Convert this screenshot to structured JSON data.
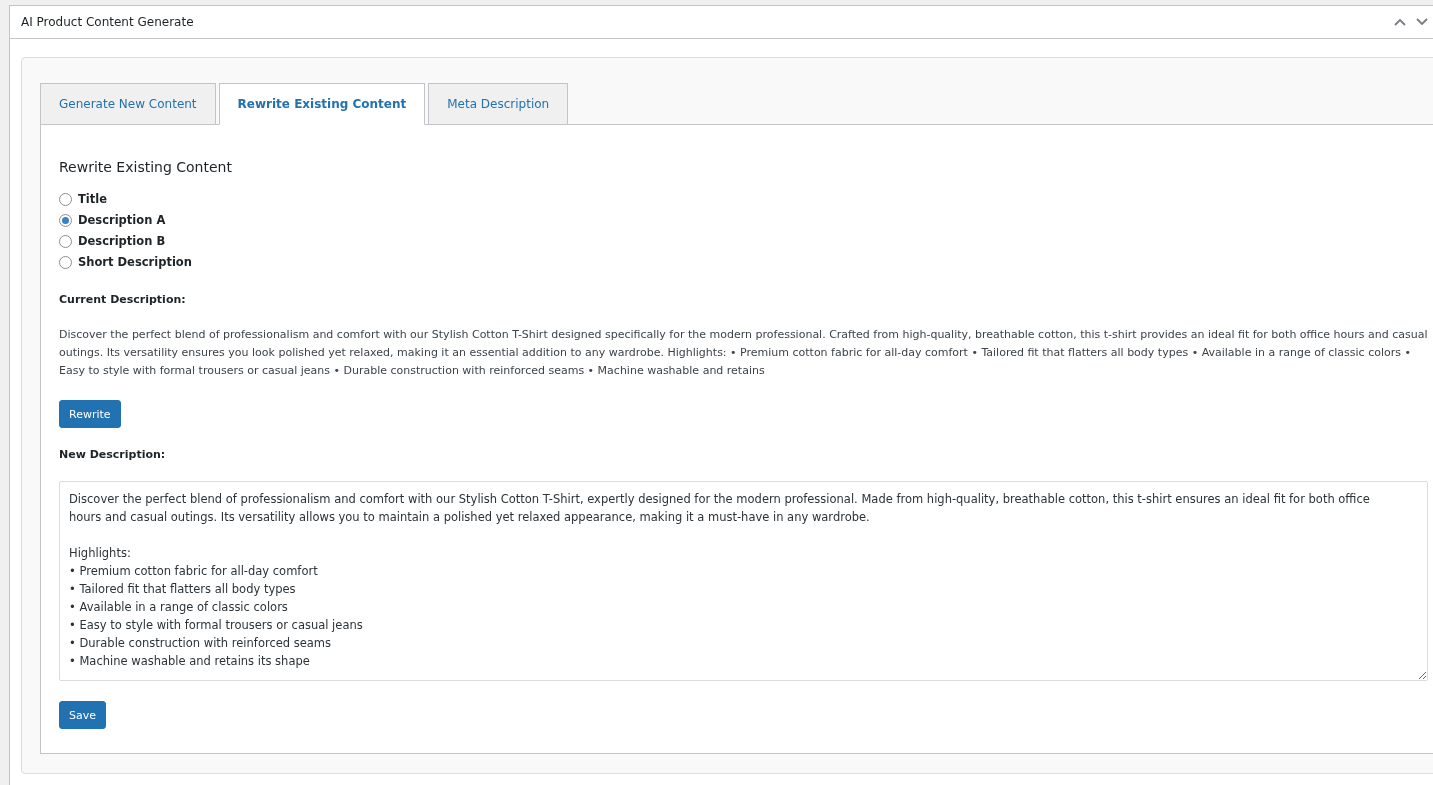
{
  "panel": {
    "title": "AI Product Content Generate"
  },
  "tabs": [
    {
      "label": "Generate New Content",
      "selected": false
    },
    {
      "label": "Rewrite Existing Content",
      "selected": true
    },
    {
      "label": "Meta Description",
      "selected": false
    }
  ],
  "section_title": "Rewrite Existing Content",
  "options": [
    {
      "label": "Title",
      "selected": false
    },
    {
      "label": "Description A",
      "selected": true
    },
    {
      "label": "Description B",
      "selected": false
    },
    {
      "label": "Short Description",
      "selected": false
    }
  ],
  "current": {
    "label": "Current Description:",
    "text": "Discover the perfect blend of professionalism and comfort with our Stylish Cotton T-Shirt designed specifically for the modern professional. Crafted from high-quality, breathable cotton, this t-shirt provides an ideal fit for both office hours and casual outings. Its versatility ensures you look polished yet relaxed, making it an essential addition to any wardrobe. Highlights: • Premium cotton fabric for all-day comfort • Tailored fit that flatters all body types • Available in a range of classic colors • Easy to style with formal trousers or casual jeans • Durable construction with reinforced seams • Machine washable and retains"
  },
  "rewrite_button": "Rewrite",
  "new": {
    "label": "New Description:",
    "value": "Discover the perfect blend of professionalism and comfort with our Stylish Cotton T-Shirt, expertly designed for the modern professional. Made from high-quality, breathable cotton, this t-shirt ensures an ideal fit for both office hours and casual outings. Its versatility allows you to maintain a polished yet relaxed appearance, making it a must-have in any wardrobe.\n\nHighlights:\n• Premium cotton fabric for all-day comfort\n• Tailored fit that flatters all body types\n• Available in a range of classic colors\n• Easy to style with formal trousers or casual jeans\n• Durable construction with reinforced seams\n• Machine washable and retains its shape"
  },
  "save_button": "Save"
}
